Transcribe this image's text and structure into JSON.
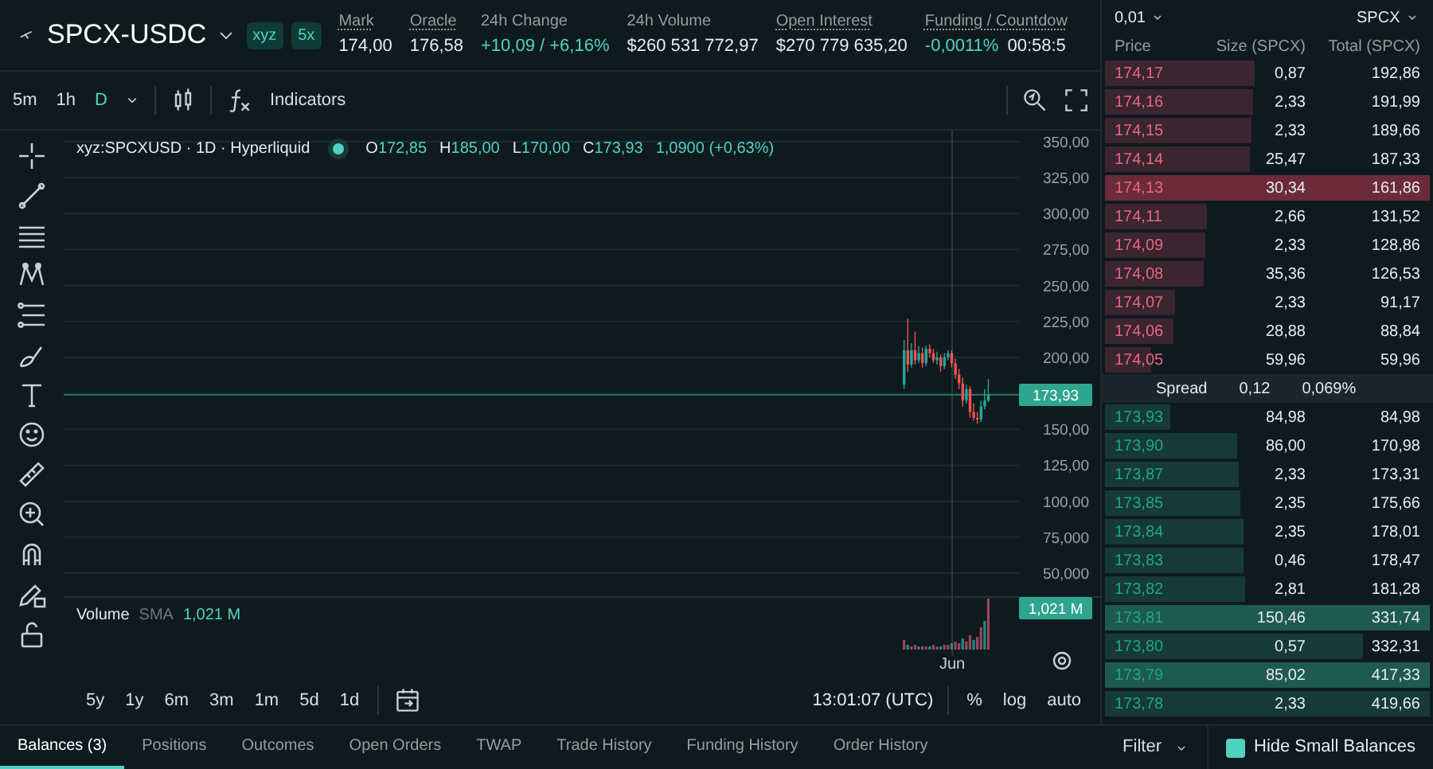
{
  "market": {
    "symbol": "SPCX-USDC",
    "badges": [
      "xyz",
      "5x"
    ]
  },
  "stats": [
    {
      "label": "Mark",
      "underlined": true,
      "values": [
        {
          "text": "174,00",
          "positive": false
        }
      ]
    },
    {
      "label": "Oracle",
      "underlined": true,
      "values": [
        {
          "text": "176,58",
          "positive": false
        }
      ]
    },
    {
      "label": "24h Change",
      "underlined": false,
      "values": [
        {
          "text": "+10,09 / +6,16%",
          "positive": true
        }
      ]
    },
    {
      "label": "24h Volume",
      "underlined": false,
      "values": [
        {
          "text": "$260 531 772,97",
          "positive": false
        }
      ]
    },
    {
      "label": "Open Interest",
      "underlined": true,
      "values": [
        {
          "text": "$270 779 635,20",
          "positive": false
        }
      ]
    },
    {
      "label": "Funding / Countdow",
      "underlined": true,
      "values": [
        {
          "text": "-0,0011%",
          "positive": true
        },
        {
          "text": "00:58:5",
          "positive": false
        }
      ]
    }
  ],
  "chart_toolbar": {
    "intervals": [
      {
        "label": "5m",
        "selected": false
      },
      {
        "label": "1h",
        "selected": false
      },
      {
        "label": "D",
        "selected": true
      }
    ],
    "indicators": "Indicators"
  },
  "legend": {
    "title": "xyz:SPCXUSD · 1D · Hyperliquid",
    "ohlc": [
      {
        "label": "O",
        "value": "172,85"
      },
      {
        "label": "H",
        "value": "185,00"
      },
      {
        "label": "L",
        "value": "170,00"
      },
      {
        "label": "C",
        "value": "173,93"
      }
    ],
    "change": "1,0900 (+0,63%)"
  },
  "price_scale": [
    "350,00",
    "325,00",
    "300,00",
    "275,00",
    "250,00",
    "225,00",
    "200,00",
    "150,00",
    "125,00",
    "100,00",
    "75,000",
    "50,000"
  ],
  "last_price": "173,93",
  "volume": {
    "label": "Volume",
    "sma": "SMA",
    "value": "1,021 M",
    "badge": "1,021 M"
  },
  "x_label": "Jun",
  "ranges": [
    "5y",
    "1y",
    "6m",
    "3m",
    "1m",
    "5d",
    "1d"
  ],
  "clock": "13:01:07 (UTC)",
  "scale_options": [
    "%",
    "log",
    "auto"
  ],
  "orderbook": {
    "tick": "0,01",
    "asset": "SPCX",
    "columns": [
      "Price",
      "Size (SPCX)",
      "Total (SPCX)"
    ],
    "asks": [
      {
        "price": "174,17",
        "size": "0,87",
        "total": "192,86",
        "highlighted": false
      },
      {
        "price": "174,16",
        "size": "2,33",
        "total": "191,99",
        "highlighted": false
      },
      {
        "price": "174,15",
        "size": "2,33",
        "total": "189,66",
        "highlighted": false
      },
      {
        "price": "174,14",
        "size": "25,47",
        "total": "187,33",
        "highlighted": false
      },
      {
        "price": "174,13",
        "size": "30,34",
        "total": "161,86",
        "highlighted": true
      },
      {
        "price": "174,11",
        "size": "2,66",
        "total": "131,52",
        "highlighted": false
      },
      {
        "price": "174,09",
        "size": "2,33",
        "total": "128,86",
        "highlighted": false
      },
      {
        "price": "174,08",
        "size": "35,36",
        "total": "126,53",
        "highlighted": false
      },
      {
        "price": "174,07",
        "size": "2,33",
        "total": "91,17",
        "highlighted": false
      },
      {
        "price": "174,06",
        "size": "28,88",
        "total": "88,84",
        "highlighted": false
      },
      {
        "price": "174,05",
        "size": "59,96",
        "total": "59,96",
        "highlighted": false
      }
    ],
    "spread": {
      "label": "Spread",
      "value": "0,12",
      "percent": "0,069%"
    },
    "bids": [
      {
        "price": "173,93",
        "size": "84,98",
        "total": "84,98",
        "highlighted": false
      },
      {
        "price": "173,90",
        "size": "86,00",
        "total": "170,98",
        "highlighted": false
      },
      {
        "price": "173,87",
        "size": "2,33",
        "total": "173,31",
        "highlighted": false
      },
      {
        "price": "173,85",
        "size": "2,35",
        "total": "175,66",
        "highlighted": false
      },
      {
        "price": "173,84",
        "size": "2,35",
        "total": "178,01",
        "highlighted": false
      },
      {
        "price": "173,83",
        "size": "0,46",
        "total": "178,47",
        "highlighted": false
      },
      {
        "price": "173,82",
        "size": "2,81",
        "total": "181,28",
        "highlighted": false
      },
      {
        "price": "173,81",
        "size": "150,46",
        "total": "331,74",
        "highlighted": true
      },
      {
        "price": "173,80",
        "size": "0,57",
        "total": "332,31",
        "highlighted": false
      },
      {
        "price": "173,79",
        "size": "85,02",
        "total": "417,33",
        "highlighted": true
      },
      {
        "price": "173,78",
        "size": "2,33",
        "total": "419,66",
        "highlighted": false
      }
    ]
  },
  "bottom_tabs": [
    {
      "label": "Balances (3)",
      "selected": true
    },
    {
      "label": "Positions",
      "selected": false
    },
    {
      "label": "Outcomes",
      "selected": false
    },
    {
      "label": "Open Orders",
      "selected": false
    },
    {
      "label": "TWAP",
      "selected": false
    },
    {
      "label": "Trade History",
      "selected": false
    },
    {
      "label": "Funding History",
      "selected": false
    },
    {
      "label": "Order History",
      "selected": false
    }
  ],
  "filter": "Filter",
  "hide_small": {
    "label": "Hide Small Balances",
    "checked": true
  }
}
